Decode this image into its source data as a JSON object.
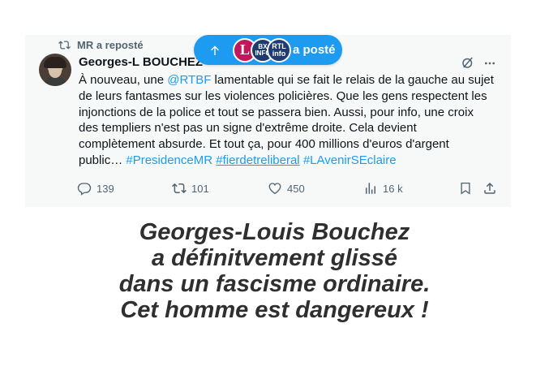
{
  "repost": {
    "text": "MR a reposté",
    "icon": "repost-icon"
  },
  "author": {
    "name": "Georges-L BOUCHEZ",
    "avatar": "avatar-photo"
  },
  "posted_pill": {
    "label": "a posté",
    "arrow_icon": "arrow-up-icon",
    "logos": [
      {
        "name": "logo-l",
        "text": "L"
      },
      {
        "name": "logo-bx",
        "text": "BX\nINFO"
      },
      {
        "name": "logo-rtl",
        "text": "RTL\ninfo"
      }
    ],
    "color": "#1d9bf0"
  },
  "tweet": {
    "line1_pre": "À nouveau, une ",
    "line1_mention": "@RTBF",
    "line1_post": " lamentable qui se fait le relais de la gauche au sujet",
    "line2": "de leurs fantasmes sur les violences policières. Que les gens respectent les",
    "line3": "injonctions de la police et tout se passera bien. Aussi, pour info, une croix",
    "line4": "des templiers n'est pas un signe d'extrême droite. Cela devient",
    "line5": "complètement absurde. Et tout ça, pour 400 millions d'euros d'argent",
    "line6_pre": "public… ",
    "hashtag1": "#PresidenceMR",
    "hashtag2": "#fierdetreliberal",
    "hashtag3": "#LAvenirSEclaire"
  },
  "actions": {
    "replies": "139",
    "reposts": "101",
    "likes": "450",
    "views": "16 k"
  },
  "caption": {
    "line1": "Georges-Louis Bouchez",
    "line2": "a définitvement glissé",
    "line3": "dans un fascisme ordinaire.",
    "line4": "Cet homme est dangereux !"
  }
}
